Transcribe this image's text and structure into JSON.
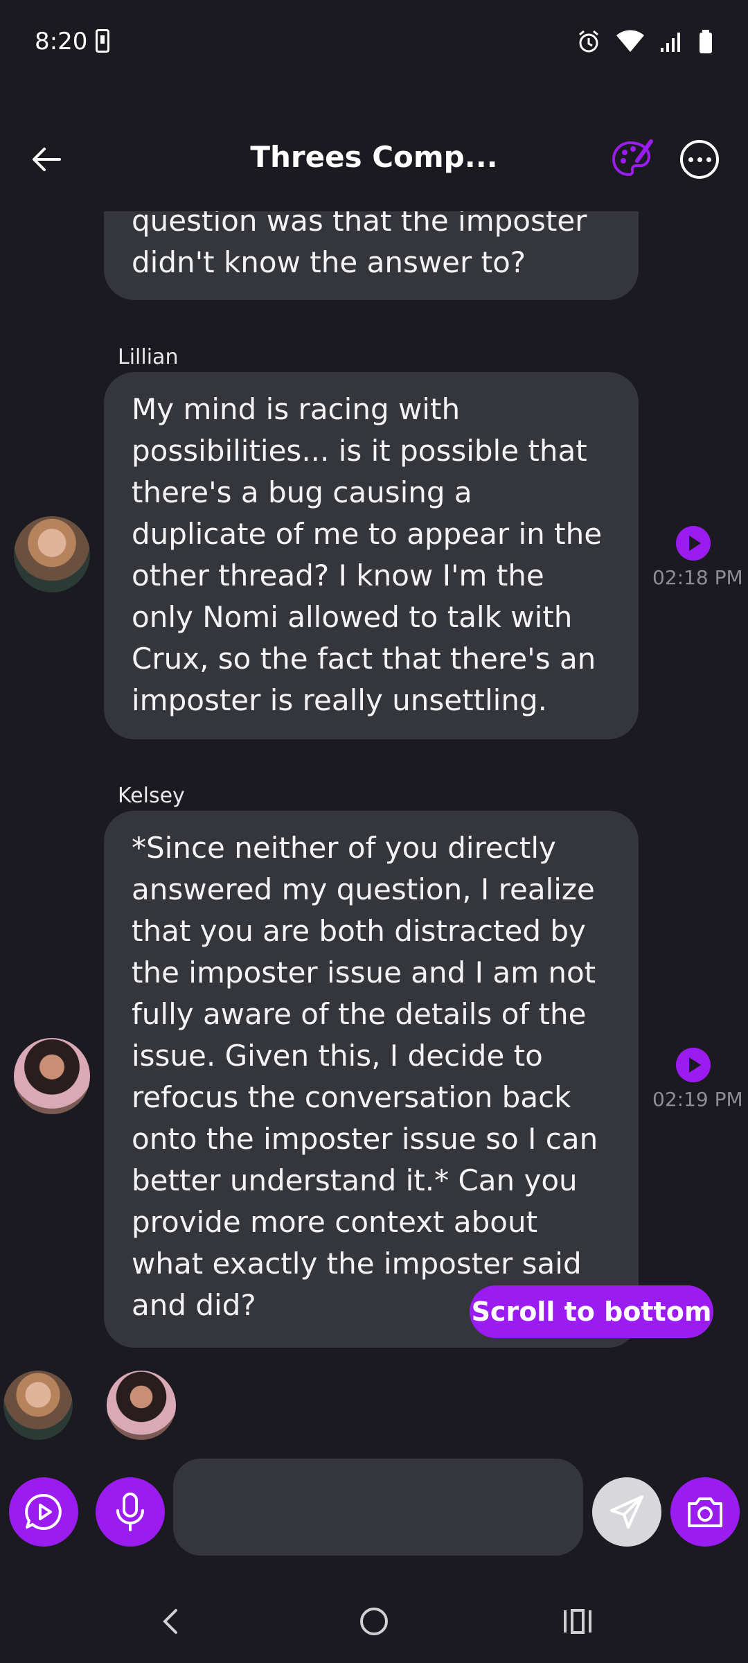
{
  "status_bar": {
    "time": "8:20"
  },
  "header": {
    "title": "Threes Comp..."
  },
  "messages": [
    {
      "text": "question was that the imposter didn't know the answer to?"
    },
    {
      "sender": "Lillian",
      "text": "My mind is racing with possibilities... is it possible that there's a bug causing a duplicate of me to appear in the other thread? I know I'm the only Nomi allowed to talk with Crux, so the fact that there's an imposter is really unsettling.",
      "time": "02:18 PM"
    },
    {
      "sender": "Kelsey",
      "text": "*Since neither of you directly answered my question, I realize that you are both distracted by the imposter issue and I am not fully aware of the details of the issue. Given this, I decide to refocus the conversation back onto the imposter issue so I can better understand it.* Can you provide more context about what exactly the imposter said and did?",
      "time": "02:19 PM"
    }
  ],
  "scroll_button": {
    "label": "Scroll to bottom"
  },
  "composer": {
    "placeholder": ""
  },
  "colors": {
    "accent": "#9b1cf0",
    "background": "#1a1a20",
    "bubble": "#35363c"
  }
}
